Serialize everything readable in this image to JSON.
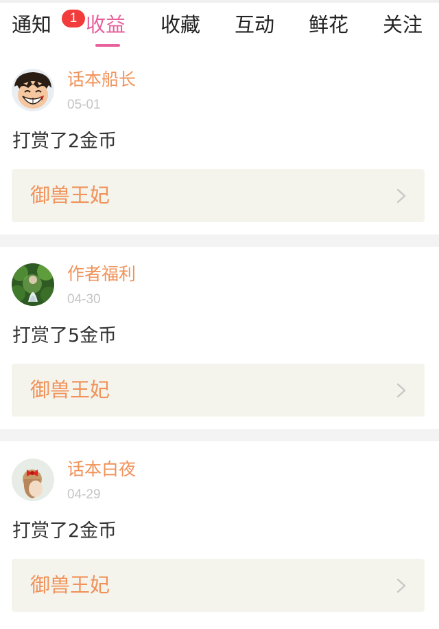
{
  "tabs": [
    {
      "label": "通知"
    },
    {
      "label": "收益"
    },
    {
      "label": "收藏"
    },
    {
      "label": "互动"
    },
    {
      "label": "鲜花"
    },
    {
      "label": "关注"
    }
  ],
  "active_tab": "收益",
  "notification_badge": "1",
  "colors": {
    "accent": "#e8609c",
    "username": "#f0925a",
    "book_title": "#f0925a",
    "badge": "#f23b3b",
    "book_card_bg": "#f5f4ec",
    "separator": "#f3f3f3"
  },
  "feed": [
    {
      "username": "话本船长",
      "date": "05-01",
      "action": "打赏了2金币",
      "book_title": "御兽王妃",
      "avatar_icon": "cartoon-pirate-avatar-icon"
    },
    {
      "username": "作者福利",
      "date": "04-30",
      "action": "打赏了5金币",
      "book_title": "御兽王妃",
      "avatar_icon": "forest-girl-avatar-icon"
    },
    {
      "username": "话本白夜",
      "date": "04-29",
      "action": "打赏了2金币",
      "book_title": "御兽王妃",
      "avatar_icon": "red-bow-girl-avatar-icon"
    }
  ]
}
